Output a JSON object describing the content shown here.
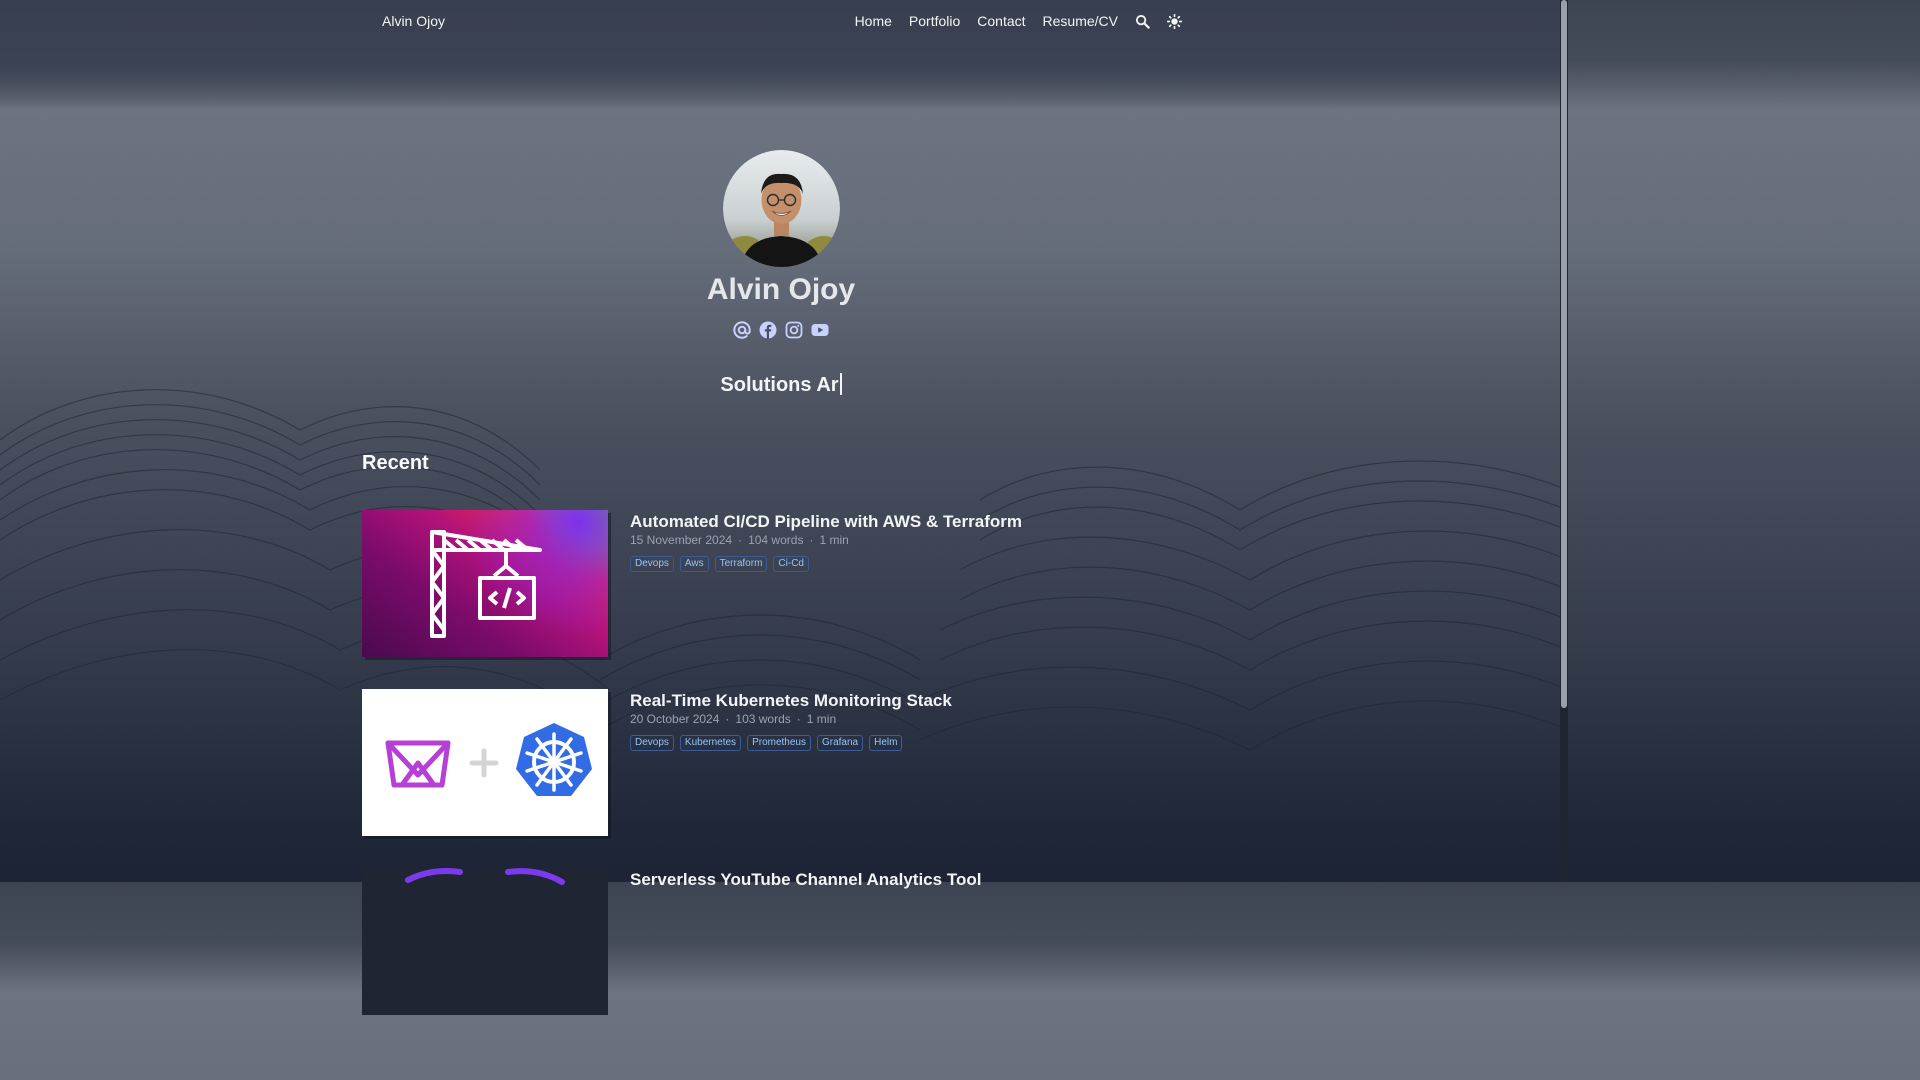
{
  "header": {
    "brand": "Alvin Ojoy",
    "nav": [
      {
        "label": "Home"
      },
      {
        "label": "Portfolio"
      },
      {
        "label": "Contact"
      },
      {
        "label": "Resume/CV"
      }
    ],
    "icons": [
      "search-icon",
      "theme-toggle-icon"
    ]
  },
  "profile": {
    "name": "Alvin Ojoy",
    "socials": [
      "email-icon",
      "facebook-icon",
      "instagram-icon",
      "youtube-icon"
    ],
    "tagline": "Solutions Ar"
  },
  "recent": {
    "heading": "Recent",
    "articles": [
      {
        "title": "Automated CI/CD Pipeline with AWS & Terraform",
        "date": "15 November 2024",
        "words": "104 words",
        "read": "1 min",
        "tags": [
          "Devops",
          "Aws",
          "Terraform",
          "Ci-Cd"
        ],
        "thumb_icon": "crane-code-icon"
      },
      {
        "title": "Real-Time Kubernetes Monitoring Stack",
        "date": "20 October 2024",
        "words": "103 words",
        "read": "1 min",
        "tags": [
          "Devops",
          "Kubernetes",
          "Prometheus",
          "Grafana",
          "Helm"
        ],
        "thumb_icon": "kubernetes-icon"
      },
      {
        "title": "Serverless YouTube Channel Analytics Tool",
        "thumb_icon": "serverless-icon"
      }
    ]
  },
  "colors": {
    "accent": "#93c5fd",
    "tag_border": "#3b5b9a",
    "kubernetes_blue": "#326ce5",
    "prometheus_purple": "#b63fd6"
  }
}
